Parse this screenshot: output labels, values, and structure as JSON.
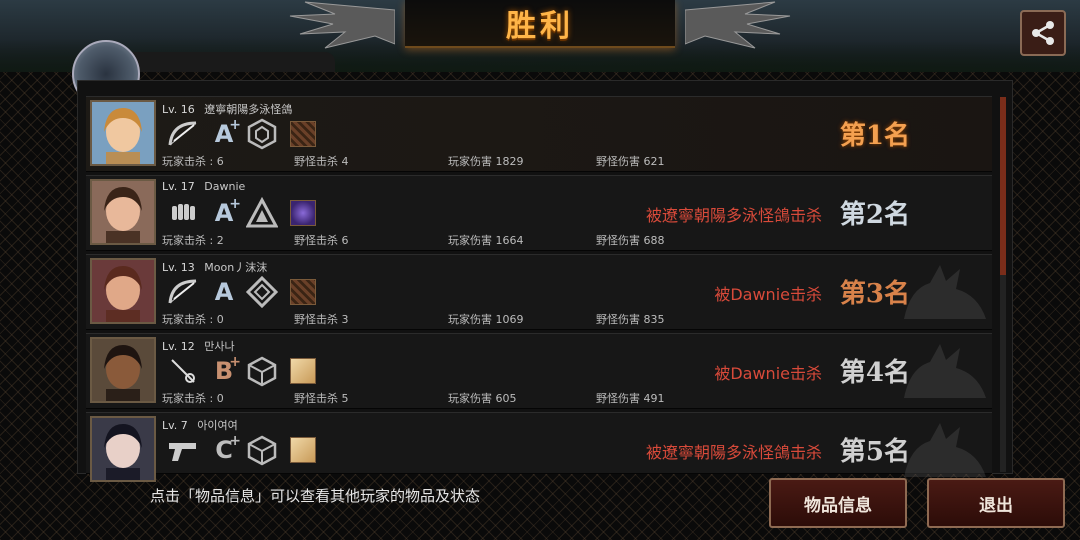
{
  "title": "胜利",
  "share_icon": "share-icon",
  "me_partial_name": "遼寧朝陽多泳怪鴿",
  "players": [
    {
      "level": "Lv. 16",
      "name": "遼寧朝陽多泳怪鴿",
      "weapon_icon": "bow-icon",
      "grade": "A",
      "grade_plus": "+",
      "class_icon": "hexagon-emblem-icon",
      "item_icon": "crossed-item-icon",
      "player_kills": "玩家击杀 : 6",
      "monster_kills": "野怪击杀 4",
      "player_damage": "玩家伤害 1829",
      "monster_damage": "野怪伤害 621",
      "killed_by": "",
      "rank": "第1名"
    },
    {
      "level": "Lv. 17",
      "name": "Dawnie",
      "weapon_icon": "fist-icon",
      "grade": "A",
      "grade_plus": "+",
      "class_icon": "triangle-emblem-icon",
      "item_icon": "purple-claw-item-icon",
      "player_kills": "玩家击杀 : 2",
      "monster_kills": "野怪击杀 6",
      "player_damage": "玩家伤害 1664",
      "monster_damage": "野怪伤害 688",
      "killed_by": "被遼寧朝陽多泳怪鴿击杀",
      "rank": "第2名"
    },
    {
      "level": "Lv. 13",
      "name": "Moon丿沫沫",
      "weapon_icon": "bow-icon",
      "grade": "A",
      "grade_plus": "",
      "class_icon": "diamond-emblem-icon",
      "item_icon": "crossed-item-icon",
      "player_kills": "玩家击杀 : 0",
      "monster_kills": "野怪击杀 3",
      "player_damage": "玩家伤害 1069",
      "monster_damage": "野怪伤害 835",
      "killed_by": "被Dawnie击杀",
      "rank": "第3名"
    },
    {
      "level": "Lv. 12",
      "name": "만사나",
      "weapon_icon": "rapier-icon",
      "grade": "B",
      "grade_plus": "+",
      "class_icon": "cube-emblem-icon",
      "item_icon": "scroll-item-icon",
      "player_kills": "玩家击杀 : 0",
      "monster_kills": "野怪击杀 5",
      "player_damage": "玩家伤害 605",
      "monster_damage": "野怪伤害 491",
      "killed_by": "被Dawnie击杀",
      "rank": "第4名"
    },
    {
      "level": "Lv. 7",
      "name": "아이여여",
      "weapon_icon": "pistol-icon",
      "grade": "C",
      "grade_plus": "+",
      "class_icon": "cube-emblem-icon",
      "item_icon": "scroll-item-icon",
      "player_kills": "",
      "monster_kills": "",
      "player_damage": "",
      "monster_damage": "",
      "killed_by": "被遼寧朝陽多泳怪鴿击杀",
      "rank": "第5名"
    }
  ],
  "footer": {
    "hint": "点击「物品信息」可以查看其他玩家的物品及状态",
    "items_button": "物品信息",
    "exit_button": "退出"
  },
  "colors": {
    "accent": "#ffb548",
    "killer_text": "#d84a3a",
    "button_bg": "#3a120c"
  }
}
